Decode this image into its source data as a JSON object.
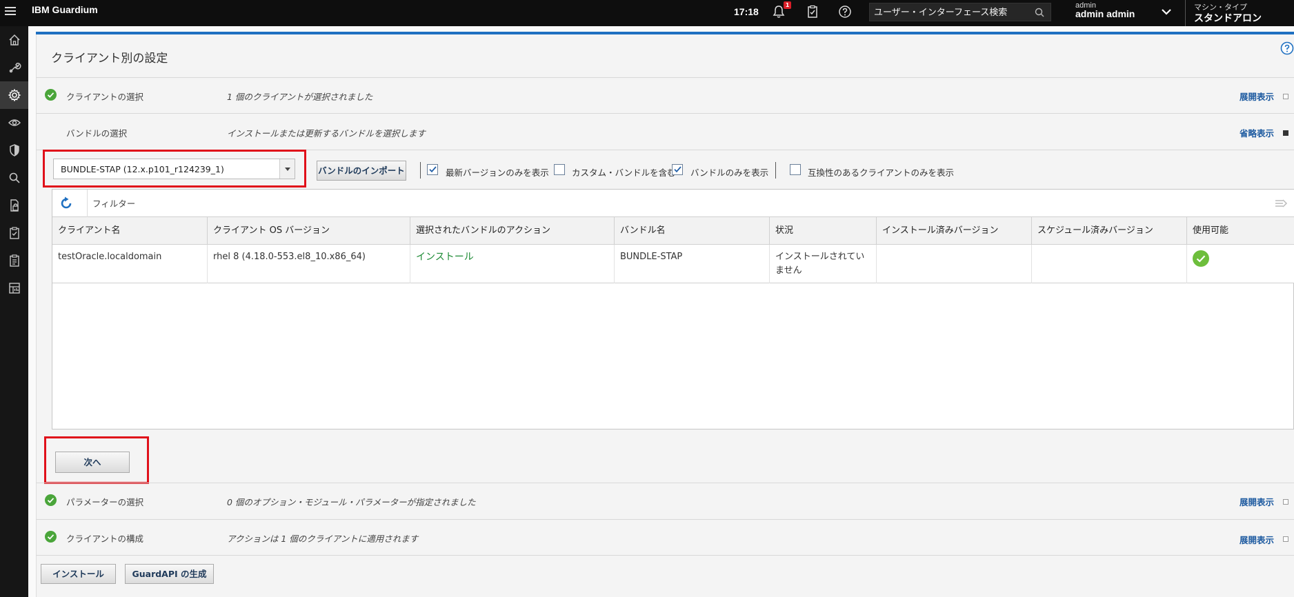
{
  "header": {
    "product": "IBM Guardium",
    "time": "17:18",
    "notification_count": "1",
    "search_placeholder": "ユーザー・インターフェース検索",
    "user_small": "admin",
    "user_name": "admin admin",
    "machine_small": "マシン・タイプ",
    "machine_type": "スタンドアロン"
  },
  "nav_icons": [
    "home-icon",
    "wrench-icon",
    "gear-icon",
    "eye-icon",
    "shield-icon",
    "search-icon",
    "report-lock-icon",
    "clipboard-check-icon",
    "clipboard-list-icon",
    "dashboard-icon"
  ],
  "page": {
    "title": "クライアント別の設定"
  },
  "steps": {
    "client_select": {
      "label": "クライアントの選択",
      "desc": "1 個のクライアントが選択されました",
      "action": "展開表示"
    },
    "bundle_select": {
      "label": "バンドルの選択",
      "desc": "インストールまたは更新するバンドルを選択します",
      "action": "省略表示"
    },
    "param_select": {
      "label": "パラメーターの選択",
      "desc": "0 個のオプション・モジュール・パラメーターが指定されました",
      "action": "展開表示"
    },
    "client_config": {
      "label": "クライアントの構成",
      "desc": "アクションは 1 個のクライアントに適用されます",
      "action": "展開表示"
    }
  },
  "bundle_toolbar": {
    "selected_bundle": "BUNDLE-STAP (12.x.p101_r124239_1)",
    "import_button": "バンドルのインポート",
    "checkboxes": [
      {
        "label": "最新バージョンのみを表示",
        "checked": true
      },
      {
        "label": "カスタム・バンドルを含む",
        "checked": false
      },
      {
        "label": "バンドルのみを表示",
        "checked": true
      },
      {
        "label": "互換性のあるクライアントのみを表示",
        "checked": false
      }
    ]
  },
  "grid": {
    "filter_placeholder": "フィルター",
    "columns": [
      "クライアント名",
      "クライアント OS バージョン",
      "選択されたバンドルのアクション",
      "バンドル名",
      "状況",
      "インストール済みバージョン",
      "スケジュール済みバージョン",
      "使用可能"
    ],
    "rows": [
      {
        "client": "testOracle.localdomain",
        "os": "rhel 8 (4.18.0-553.el8_10.x86_64)",
        "action": "インストール",
        "bundle": "BUNDLE-STAP",
        "status": "インストールされていません",
        "installed": "",
        "scheduled": "",
        "available": "check-icon"
      }
    ]
  },
  "buttons": {
    "next": "次へ",
    "install": "インストール",
    "guardapi": "GuardAPI の生成"
  },
  "colors": {
    "accent_blue": "#1f70c1",
    "highlight_red": "#e0101a",
    "success_green": "#4aa53a",
    "link_blue": "#1d5aa0",
    "action_green": "#1c8a34"
  }
}
